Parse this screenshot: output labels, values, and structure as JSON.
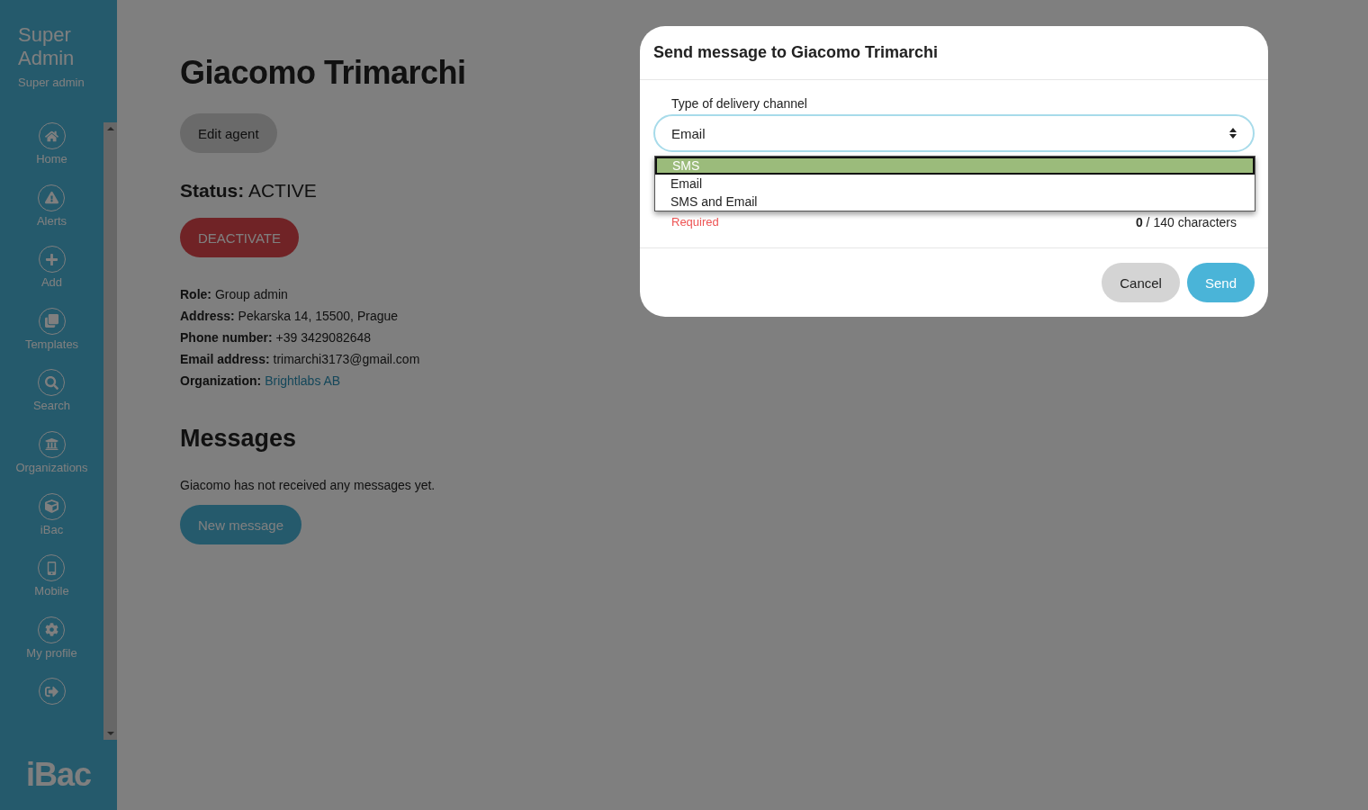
{
  "sidebar": {
    "title": "Super Admin",
    "subtitle": "Super admin",
    "items": [
      {
        "kind": "home",
        "label": "Home"
      },
      {
        "kind": "alerts",
        "label": "Alerts"
      },
      {
        "kind": "add",
        "label": "Add"
      },
      {
        "kind": "templates",
        "label": "Templates"
      },
      {
        "kind": "search",
        "label": "Search"
      },
      {
        "kind": "organizations",
        "label": "Organizations"
      },
      {
        "kind": "ibac",
        "label": "iBac"
      },
      {
        "kind": "mobile",
        "label": "Mobile"
      },
      {
        "kind": "profile",
        "label": "My profile"
      },
      {
        "kind": "logout"
      }
    ],
    "logo": "iBac"
  },
  "agent": {
    "name": "Giacomo Trimarchi",
    "edit_button": "Edit agent",
    "status_label": "Status:",
    "status": "ACTIVE",
    "deactivate_button": "DEACTIVATE",
    "details": [
      {
        "label": "Role:",
        "value": "Group admin",
        "kind": "text"
      },
      {
        "label": "Address:",
        "value": "Pekarska 14, 15500, Prague",
        "kind": "text"
      },
      {
        "label": "Phone number:",
        "value": "+39 3429082648",
        "kind": "text"
      },
      {
        "label": "Email address:",
        "value": "trimarchi3173@gmail.com",
        "kind": "text"
      },
      {
        "label": "Organization:",
        "value": "Brightlabs AB",
        "kind": "link"
      }
    ]
  },
  "messages": {
    "heading": "Messages",
    "empty_text": "Giacomo has not received any messages yet.",
    "new_button": "New message"
  },
  "modal": {
    "title": "Send message to Giacomo Trimarchi",
    "field_label": "Type of delivery channel",
    "value": "Email",
    "options": [
      {
        "label": "SMS",
        "highlighted": true
      },
      {
        "label": "Email",
        "highlighted": false
      },
      {
        "label": "SMS and Email",
        "highlighted": false
      }
    ],
    "error": "Required",
    "counter": "**0** / 140 characters",
    "cancel_button": "Cancel",
    "send_button": "Send"
  }
}
